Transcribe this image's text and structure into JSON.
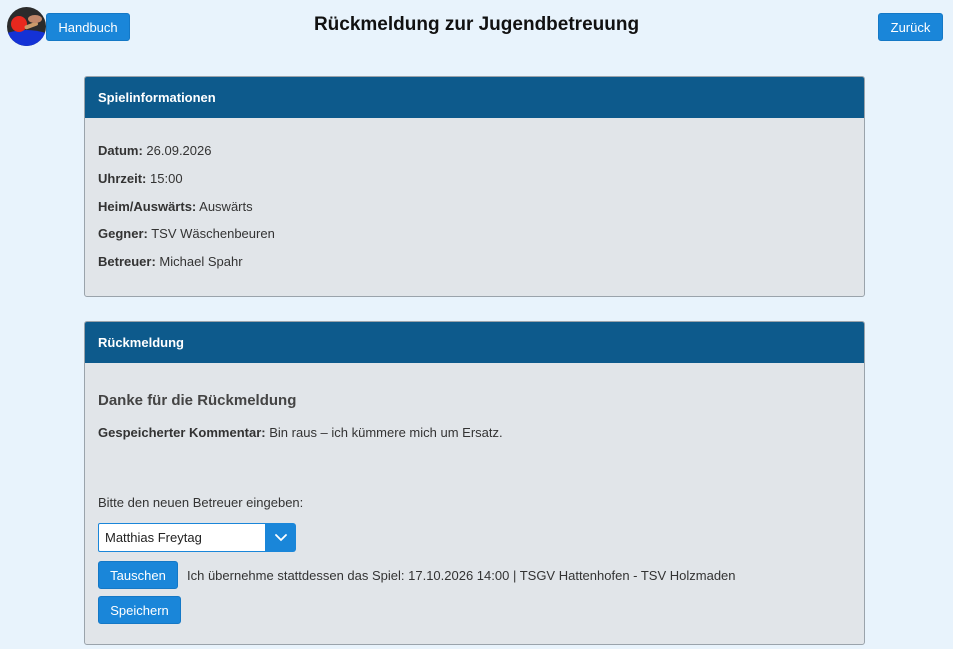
{
  "header": {
    "logo_icon": "table-tennis-logo",
    "manual_button": "Handbuch",
    "title": "Rückmeldung zur Jugendbetreuung",
    "back_button": "Zurück"
  },
  "game_info": {
    "heading": "Spielinformationen",
    "rows": [
      {
        "label": "Datum:",
        "value": "26.09.2026"
      },
      {
        "label": "Uhrzeit:",
        "value": "15:00"
      },
      {
        "label": "Heim/Auswärts:",
        "value": "Auswärts"
      },
      {
        "label": "Gegner:",
        "value": "TSV Wäschenbeuren"
      },
      {
        "label": "Betreuer:",
        "value": "Michael Spahr"
      }
    ]
  },
  "feedback": {
    "heading": "Rückmeldung",
    "thanks": "Danke für die Rückmeldung",
    "comment_label": "Gespeicherter Kommentar:",
    "comment_value": "Bin raus – ich kümmere mich um Ersatz.",
    "new_supervisor_prompt": "Bitte den neuen Betreuer eingeben:",
    "supervisor_input_value": "Matthias Freytag",
    "dropdown_icon": "chevron-down-icon",
    "swap_button": "Tauschen",
    "swap_text": "Ich übernehme stattdessen das Spiel: 17.10.2026 14:00 | TSGV Hattenhofen - TSV Holzmaden",
    "save_button": "Speichern"
  },
  "colors": {
    "accent": "#1a86d9",
    "card_header": "#0d5a8c",
    "background": "#e8f3fc",
    "card_body": "#e1e5e9"
  }
}
